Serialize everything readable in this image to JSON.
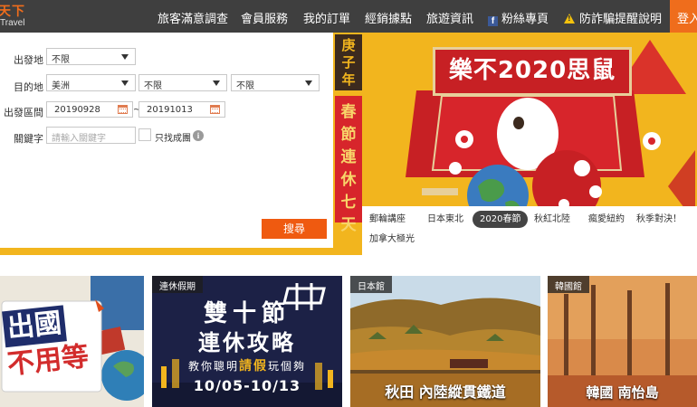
{
  "brand": {
    "logo_cn": "天下",
    "logo_en": "Travel"
  },
  "nav": {
    "items": [
      "旅客滿意調查",
      "會員服務",
      "我的訂單",
      "經銷據點",
      "旅遊資訊"
    ],
    "fans": "粉絲專頁",
    "fraud": "防詐騙提醒說明",
    "login": "登入"
  },
  "search": {
    "departure_label": "出發地",
    "departure_value": "不限",
    "destination_label": "目的地",
    "destination_values": [
      "美洲",
      "不限",
      "不限"
    ],
    "date_label": "出發區間",
    "date_from": "20190928",
    "date_sep": "~",
    "date_to": "20191013",
    "keyword_label": "關鍵字",
    "keyword_placeholder": "請輸入關鍵字",
    "confirmed_only": "只找成團",
    "submit": "搜尋"
  },
  "banner": {
    "vertical_title": "庚子年",
    "vertical_sub": "春節連休七天",
    "headline": "樂不2020思鼠",
    "tabs": [
      "郵輪講座",
      "日本東北",
      "2020春節",
      "秋紅北陸",
      "瘋愛紐約",
      "秋季對決！",
      "加拿大極光"
    ],
    "active_tab": "2020春節"
  },
  "cards": [
    {
      "tag": "",
      "caption_line1": "出國",
      "caption_line2": "不用等"
    },
    {
      "tag": "連休假期",
      "caption_line1": "雙十節",
      "caption_line2": "連休攻略",
      "caption_line3_pre": "教你聰明",
      "caption_line3_em": "請假",
      "caption_line3_post": "玩個夠",
      "caption_line4": "10/05-10/13"
    },
    {
      "tag": "日本館",
      "caption": "秋田 內陸縱貫鐵道"
    },
    {
      "tag": "韓國館",
      "caption": "韓國 南怡島"
    }
  ],
  "colors": {
    "accent": "#ef6d1c",
    "nav_bg": "#3f3f3f",
    "banner_yellow": "#f2b51e",
    "banner_red": "#d7252b"
  }
}
